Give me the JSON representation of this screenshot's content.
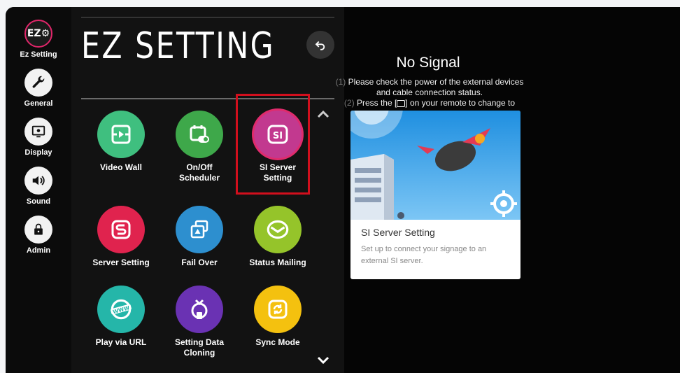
{
  "sidebar": {
    "items": [
      {
        "label": "Ez Setting",
        "icon": "ez-setting-icon",
        "badge": "EZ⚙"
      },
      {
        "label": "General",
        "icon": "wrench-icon"
      },
      {
        "label": "Display",
        "icon": "display-icon"
      },
      {
        "label": "Sound",
        "icon": "speaker-icon"
      },
      {
        "label": "Admin",
        "icon": "lock-icon"
      }
    ]
  },
  "panel": {
    "title": "EZ SETTING",
    "tiles": [
      {
        "label": "Video Wall",
        "color": "#3fbf7f",
        "icon": "video-wall-icon"
      },
      {
        "label": "On/Off\nScheduler",
        "color": "#3ea84a",
        "icon": "scheduler-icon"
      },
      {
        "label": "SI Server\nSetting",
        "color": "#c2398f",
        "icon": "si-server-icon",
        "selected": true
      },
      {
        "label": "Server Setting",
        "color": "#e0234e",
        "icon": "server-setting-icon"
      },
      {
        "label": "Fail Over",
        "color": "#2d8fcf",
        "icon": "fail-over-icon"
      },
      {
        "label": "Status Mailing",
        "color": "#95c42a",
        "icon": "mail-icon"
      },
      {
        "label": "Play via URL",
        "color": "#25b6a9",
        "icon": "www-icon"
      },
      {
        "label": "Setting Data\nCloning",
        "color": "#6a32b3",
        "icon": "cloning-icon"
      },
      {
        "label": "Sync Mode",
        "color": "#f4c10f",
        "icon": "sync-icon"
      }
    ]
  },
  "no_signal": {
    "title": "No Signal",
    "line1_num": "(1)",
    "line1": "Please check the power of the external devices",
    "line2": "and cable connection status.",
    "line3_num": "(2)",
    "line3": "Press the [",
    "line3_icon": "input-icon",
    "line3_end": "] on your remote to change to"
  },
  "card": {
    "title": "SI Server Setting",
    "description": "Set up to connect your signage to an external SI server."
  }
}
